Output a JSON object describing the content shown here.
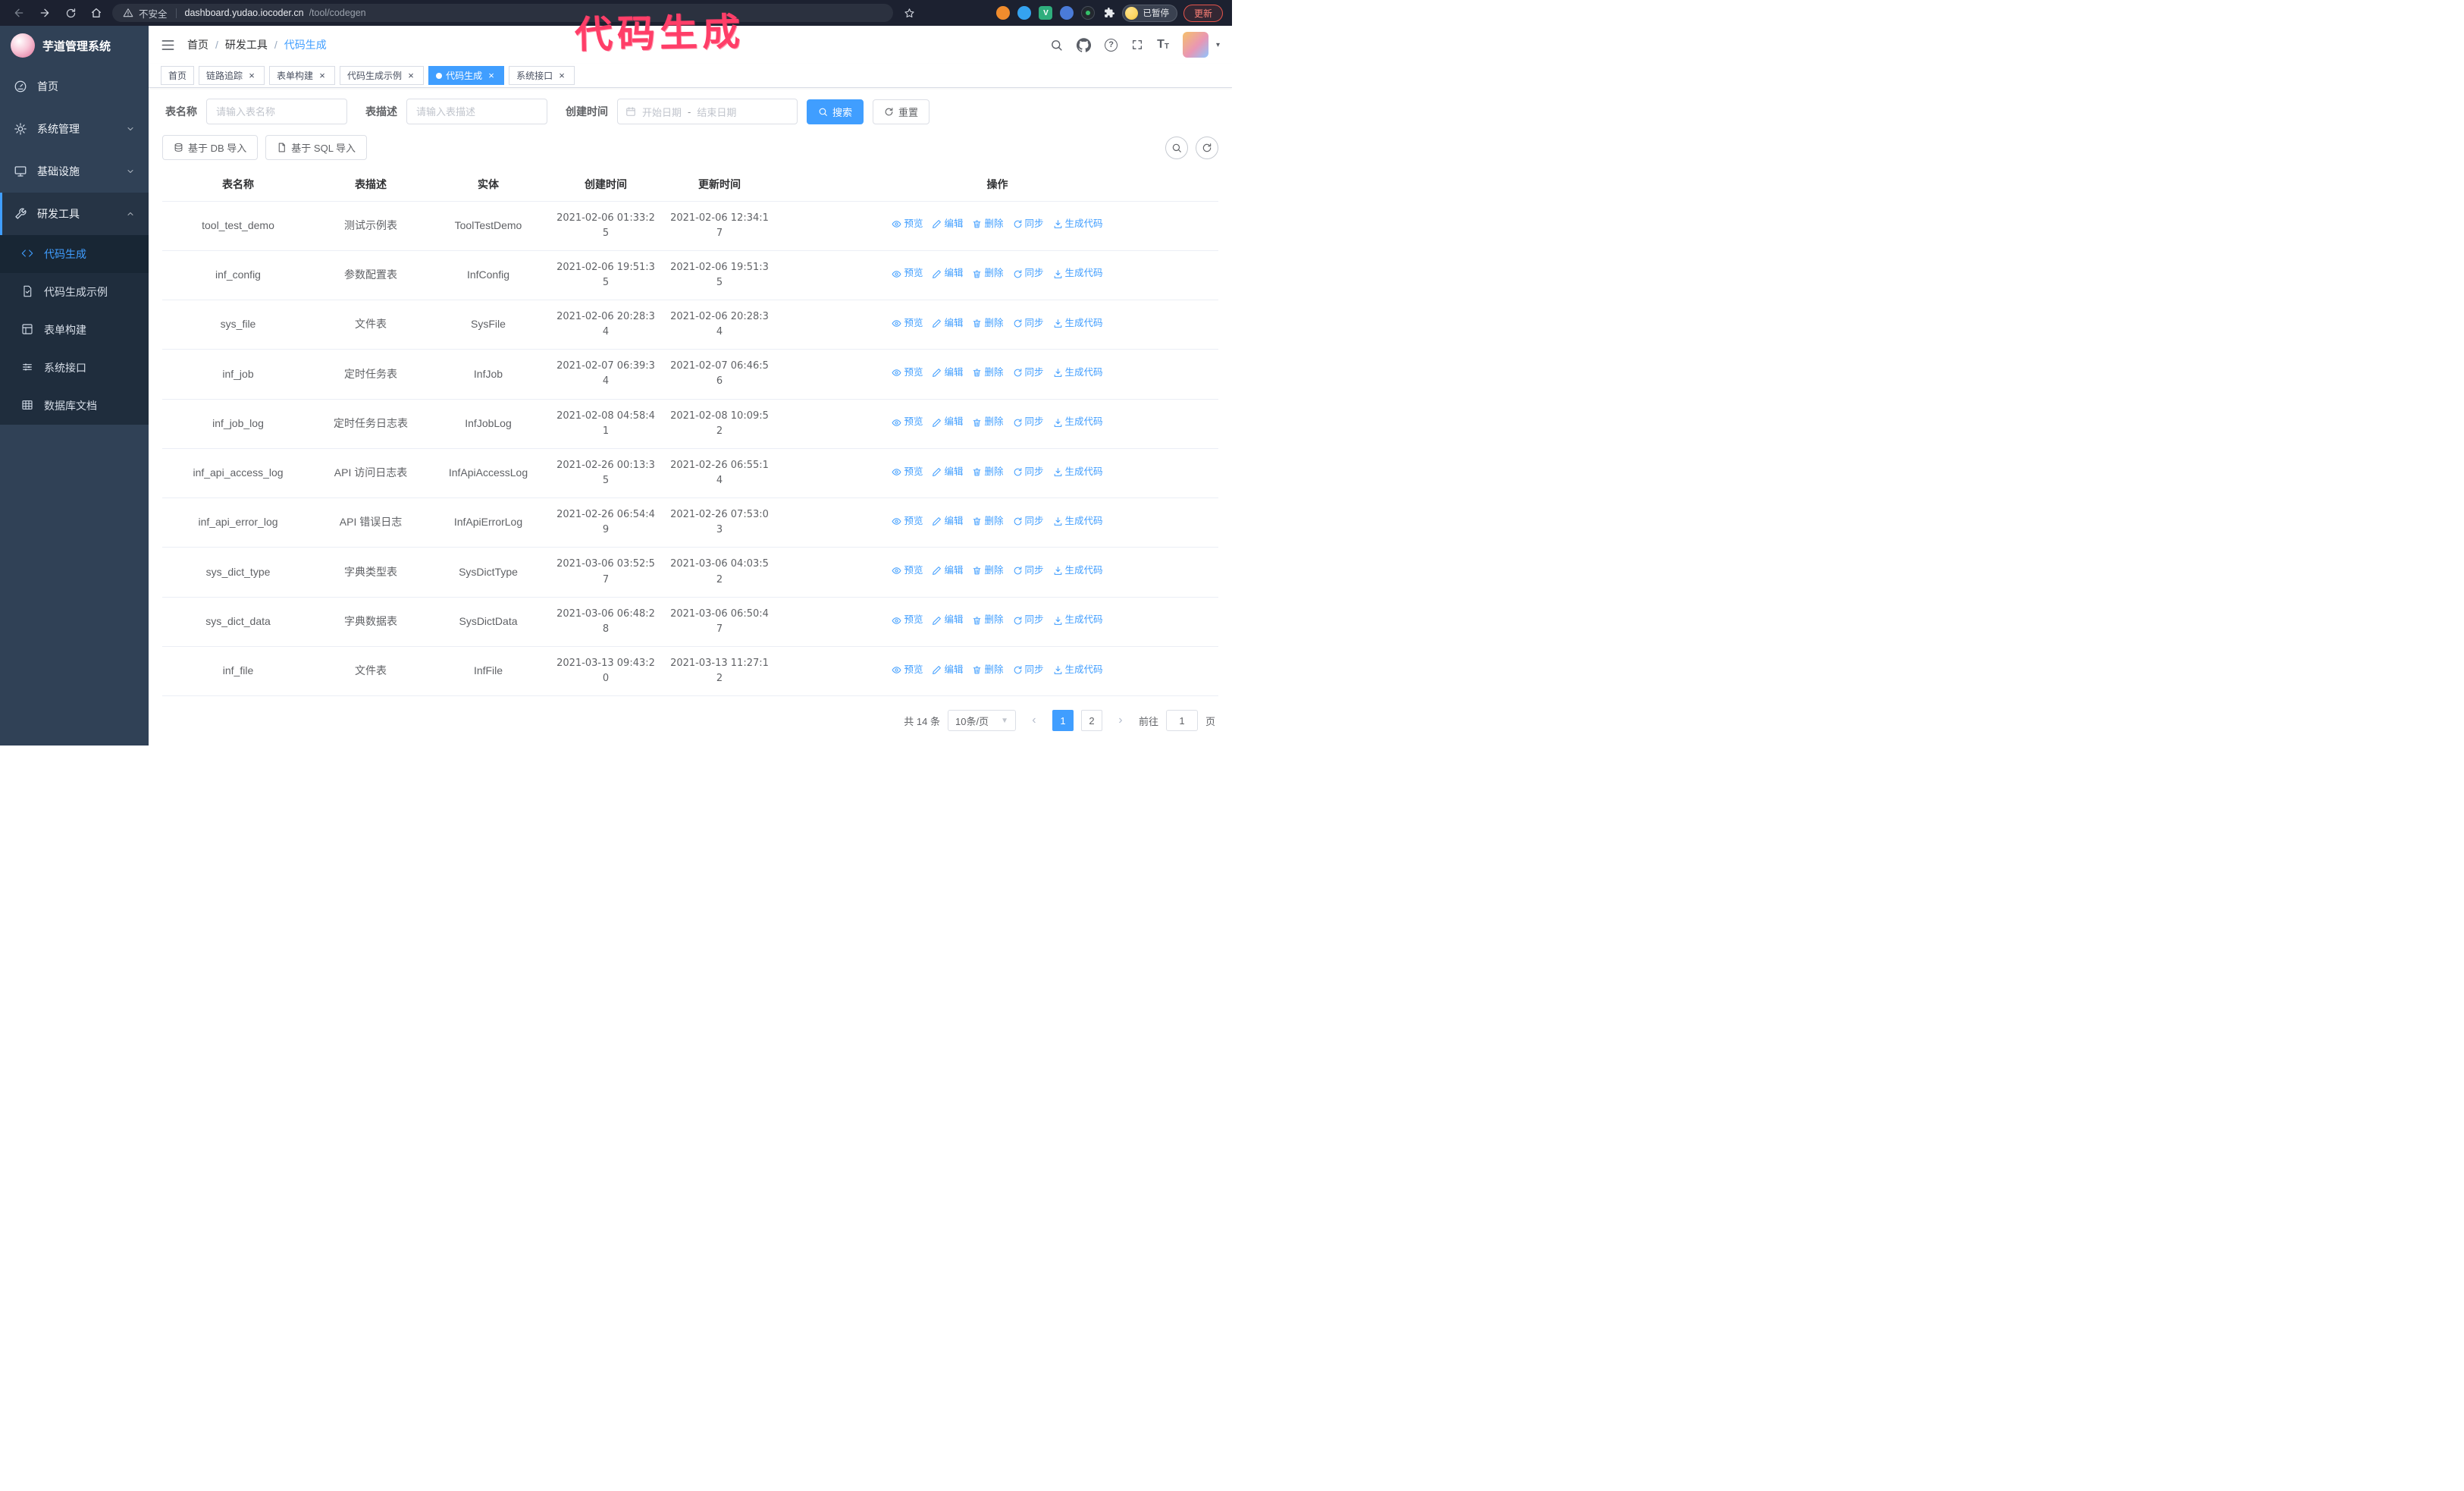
{
  "colors": {
    "accent": "#409eff",
    "sidebar_bg": "#304156",
    "sidebar_submenu_bg": "#1f2d3d",
    "chrome_bg": "#1c2130",
    "annotation_pink": "#ff3e68",
    "table_border": "#ebeef5"
  },
  "annotation": {
    "text": "代码生成"
  },
  "browser": {
    "security_text": "不安全",
    "url_host": "dashboard.yudao.iocoder.cn",
    "url_path": "/tool/codegen",
    "paused_badge": "已暂停",
    "update_button": "更新",
    "nav_icons": [
      "back-icon",
      "forward-icon",
      "reload-icon",
      "home-icon"
    ],
    "bookmark_icon": "star-icon",
    "extension_icons": [
      "extension-icon-orange",
      "extension-icon-blue-drop",
      "extension-icon-vue",
      "extension-icon-grid",
      "extension-icon-dark",
      "puzzle-icon"
    ]
  },
  "sidebar": {
    "logo_title": "芋道管理系统",
    "items": [
      {
        "label": "首页",
        "icon": "dashboard-icon"
      },
      {
        "label": "系统管理",
        "icon": "gear-icon",
        "chevron": "down"
      },
      {
        "label": "基础设施",
        "icon": "monitor-icon",
        "chevron": "down"
      },
      {
        "label": "研发工具",
        "icon": "wrench-icon",
        "chevron": "up",
        "expanded": true
      }
    ],
    "subitems": [
      {
        "label": "代码生成",
        "icon": "code-icon",
        "active": true
      },
      {
        "label": "代码生成示例",
        "icon": "example-icon"
      },
      {
        "label": "表单构建",
        "icon": "form-icon"
      },
      {
        "label": "系统接口",
        "icon": "api-icon"
      },
      {
        "label": "数据库文档",
        "icon": "db-doc-icon"
      }
    ]
  },
  "header": {
    "breadcrumb": [
      {
        "label": "首页"
      },
      {
        "label": "研发工具"
      },
      {
        "label": "代码生成"
      }
    ],
    "right_icons": [
      "search-icon",
      "github-icon",
      "question-icon",
      "fullscreen-icon",
      "font-size-icon",
      "avatar"
    ]
  },
  "tabs": [
    {
      "label": "首页",
      "closable": false,
      "active": false
    },
    {
      "label": "链路追踪",
      "closable": true,
      "active": false
    },
    {
      "label": "表单构建",
      "closable": true,
      "active": false
    },
    {
      "label": "代码生成示例",
      "closable": true,
      "active": false
    },
    {
      "label": "代码生成",
      "closable": true,
      "active": true
    },
    {
      "label": "系统接口",
      "closable": true,
      "active": false
    }
  ],
  "filters": {
    "table_name": {
      "label": "表名称",
      "placeholder": "请输入表名称",
      "value": ""
    },
    "table_desc": {
      "label": "表描述",
      "placeholder": "请输入表描述",
      "value": ""
    },
    "create_time": {
      "label": "创建时间",
      "start_placeholder": "开始日期",
      "separator": "-",
      "end_placeholder": "结束日期"
    },
    "search_button": "搜索",
    "reset_button": "重置"
  },
  "toolbar": {
    "import_db_button": "基于 DB 导入",
    "import_sql_button": "基于 SQL 导入",
    "mini_buttons": [
      "search-icon",
      "refresh-icon"
    ]
  },
  "table": {
    "columns": [
      "表名称",
      "表描述",
      "实体",
      "创建时间",
      "更新时间",
      "操作"
    ],
    "actions": [
      {
        "label": "预览",
        "icon": "eye-icon"
      },
      {
        "label": "编辑",
        "icon": "edit-icon"
      },
      {
        "label": "删除",
        "icon": "delete-icon"
      },
      {
        "label": "同步",
        "icon": "sync-icon"
      },
      {
        "label": "生成代码",
        "icon": "download-icon"
      }
    ],
    "rows": [
      {
        "name": "tool_test_demo",
        "desc": "测试示例表",
        "entity": "ToolTestDemo",
        "created": "2021-02-06 01:33:25",
        "updated": "2021-02-06 12:34:17"
      },
      {
        "name": "inf_config",
        "desc": "参数配置表",
        "entity": "InfConfig",
        "created": "2021-02-06 19:51:35",
        "updated": "2021-02-06 19:51:35"
      },
      {
        "name": "sys_file",
        "desc": "文件表",
        "entity": "SysFile",
        "created": "2021-02-06 20:28:34",
        "updated": "2021-02-06 20:28:34"
      },
      {
        "name": "inf_job",
        "desc": "定时任务表",
        "entity": "InfJob",
        "created": "2021-02-07 06:39:34",
        "updated": "2021-02-07 06:46:56"
      },
      {
        "name": "inf_job_log",
        "desc": "定时任务日志表",
        "entity": "InfJobLog",
        "created": "2021-02-08 04:58:41",
        "updated": "2021-02-08 10:09:52"
      },
      {
        "name": "inf_api_access_log",
        "desc": "API 访问日志表",
        "entity": "InfApiAccessLog",
        "created": "2021-02-26 00:13:35",
        "updated": "2021-02-26 06:55:14"
      },
      {
        "name": "inf_api_error_log",
        "desc": "API 错误日志",
        "entity": "InfApiErrorLog",
        "created": "2021-02-26 06:54:49",
        "updated": "2021-02-26 07:53:03"
      },
      {
        "name": "sys_dict_type",
        "desc": "字典类型表",
        "entity": "SysDictType",
        "created": "2021-03-06 03:52:57",
        "updated": "2021-03-06 04:03:52"
      },
      {
        "name": "sys_dict_data",
        "desc": "字典数据表",
        "entity": "SysDictData",
        "created": "2021-03-06 06:48:28",
        "updated": "2021-03-06 06:50:47"
      },
      {
        "name": "inf_file",
        "desc": "文件表",
        "entity": "InfFile",
        "created": "2021-03-13 09:43:20",
        "updated": "2021-03-13 11:27:12"
      }
    ]
  },
  "pagination": {
    "total_text": "共 14 条",
    "page_size": "10条/页",
    "pages": [
      "1",
      "2"
    ],
    "active_page": "1",
    "goto_label": "前往",
    "goto_value": "1",
    "goto_suffix": "页"
  }
}
